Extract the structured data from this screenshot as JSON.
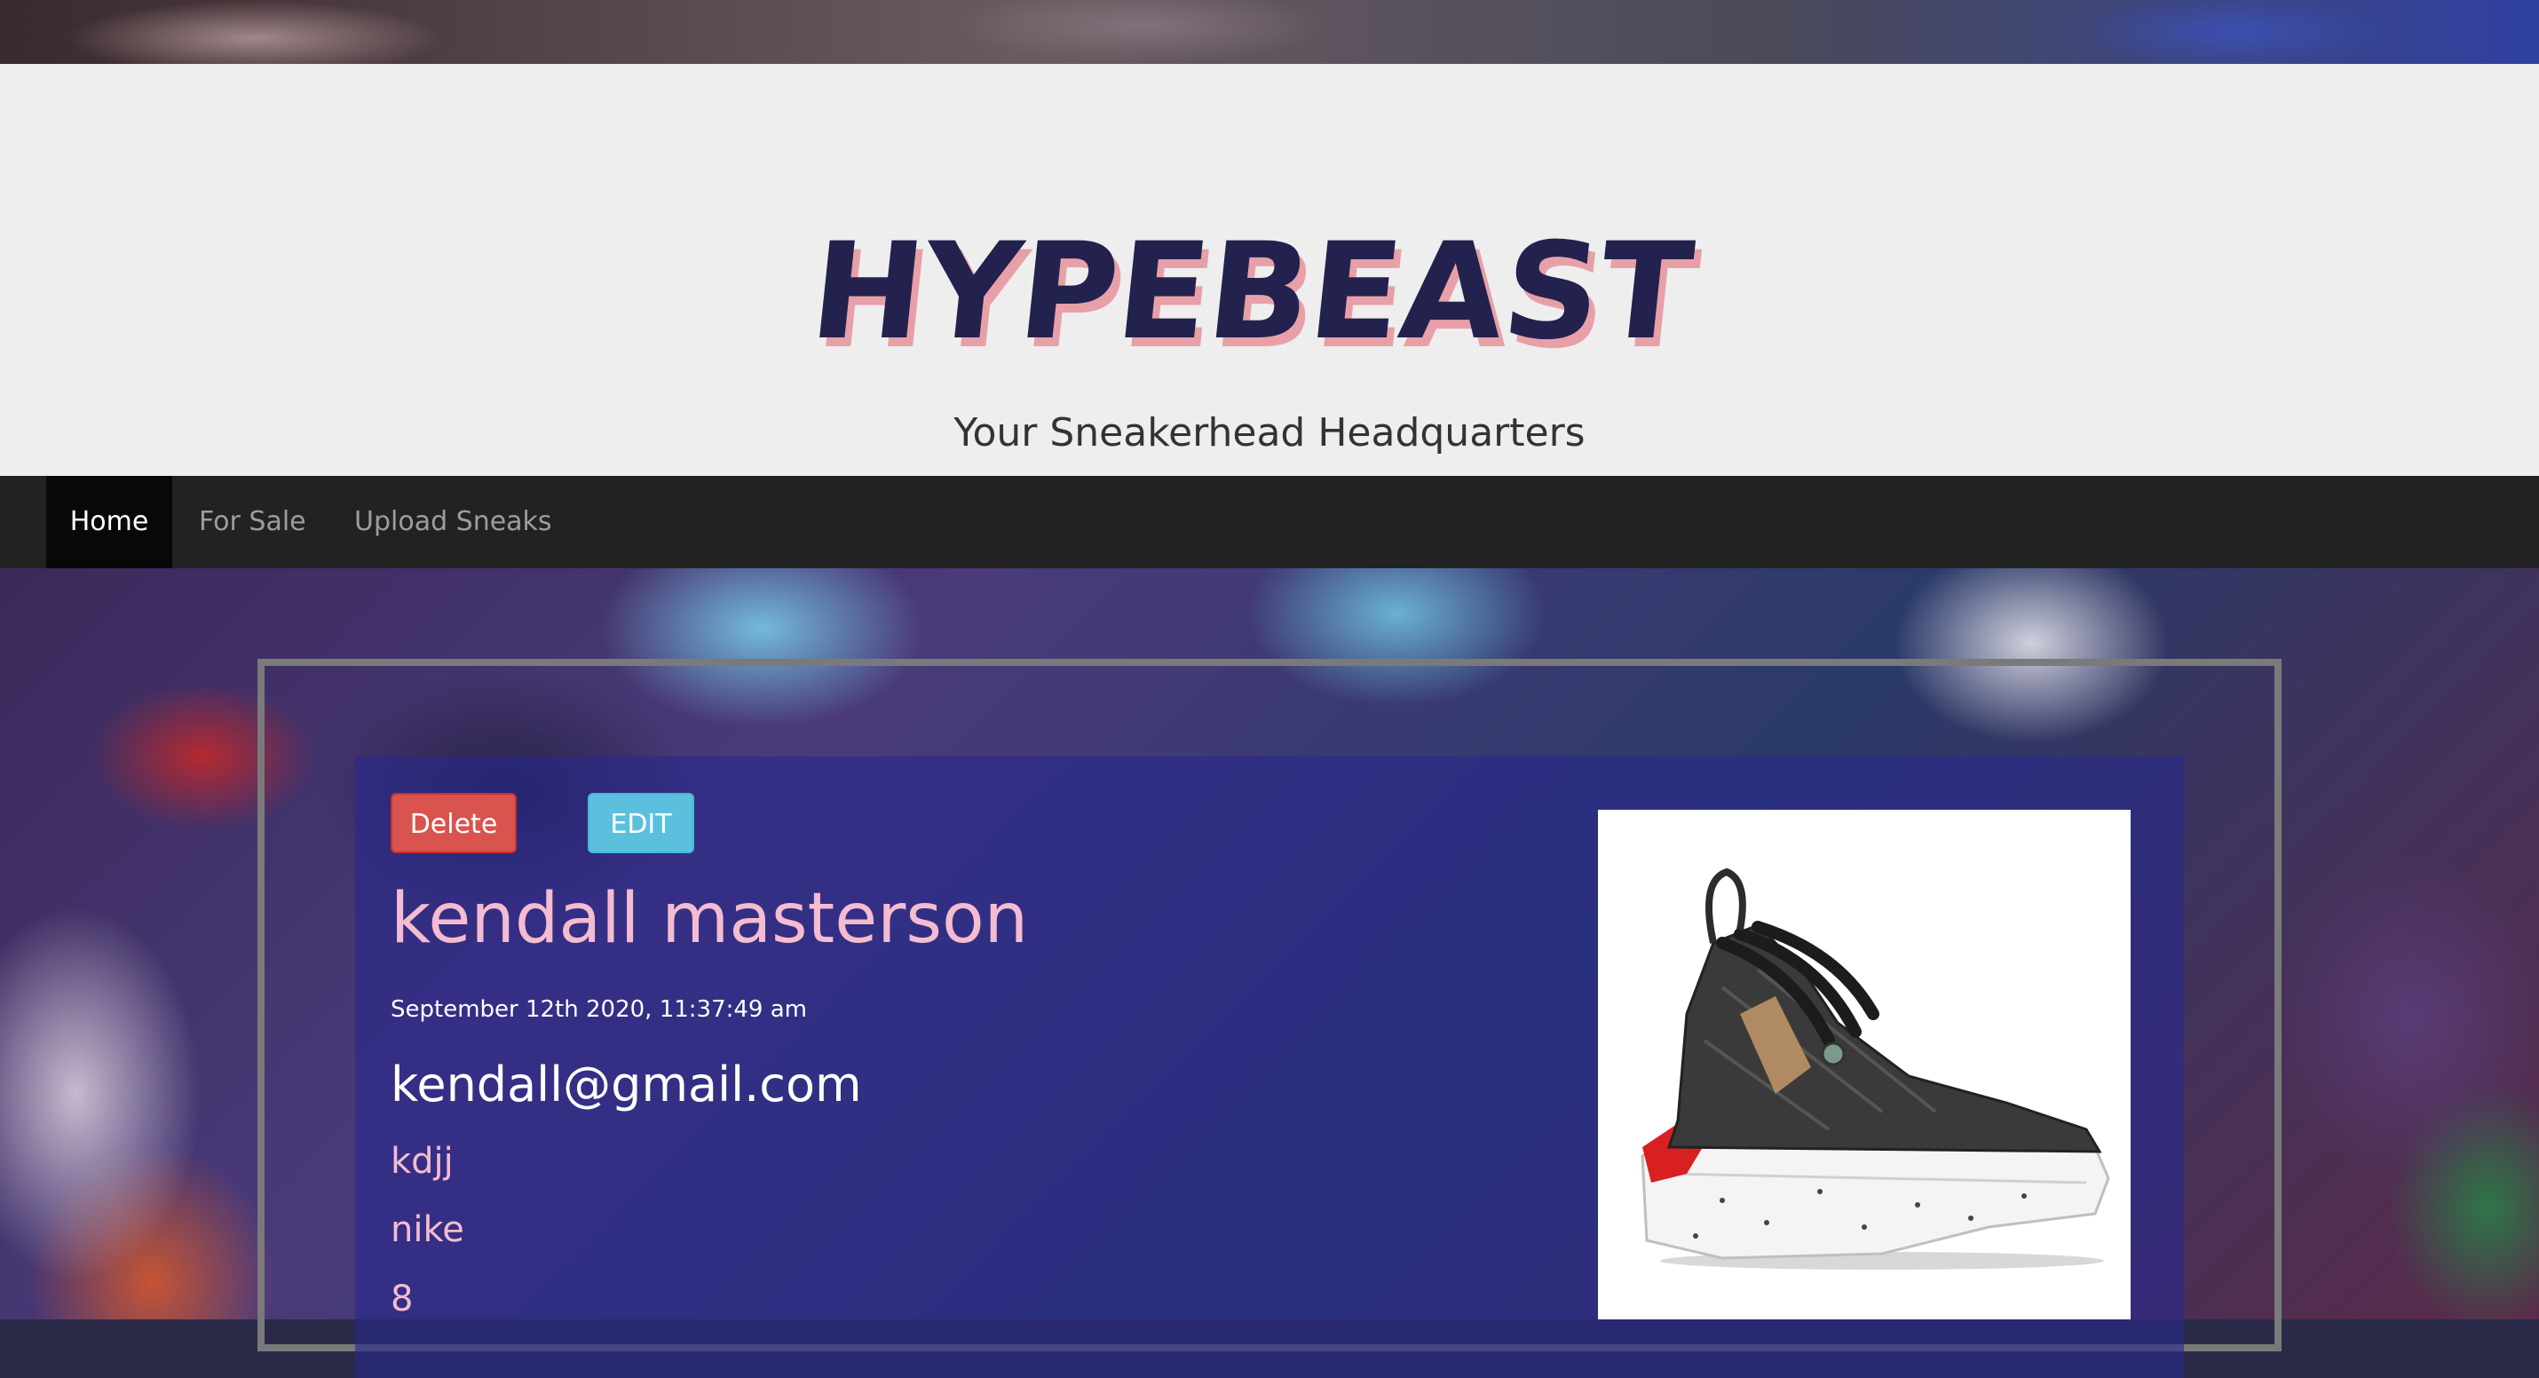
{
  "header": {
    "logo_text": "HYPEBEAST",
    "tagline": "Your Sneakerhead Headquarters"
  },
  "nav": {
    "items": [
      {
        "label": "Home",
        "active": true
      },
      {
        "label": "For Sale",
        "active": false
      },
      {
        "label": "Upload Sneaks",
        "active": false
      }
    ]
  },
  "post": {
    "delete_label": "Delete",
    "edit_label": "EDIT",
    "name": "kendall masterson",
    "timestamp": "September 12th 2020, 11:37:49 am",
    "email": "kendall@gmail.com",
    "details": [
      "kdjj",
      "nike",
      "8"
    ],
    "image_icon": "sneaker-image"
  },
  "colors": {
    "header_bg": "#eeeeee",
    "navbar_bg": "#222222",
    "logo_fill": "#23224e",
    "logo_shadow": "#e8a0a8",
    "name_color": "#f4bcd0",
    "delete_bg": "#d9534f",
    "edit_bg": "#5bc0de",
    "card_bg": "rgba(40,40,140,0.62)"
  }
}
